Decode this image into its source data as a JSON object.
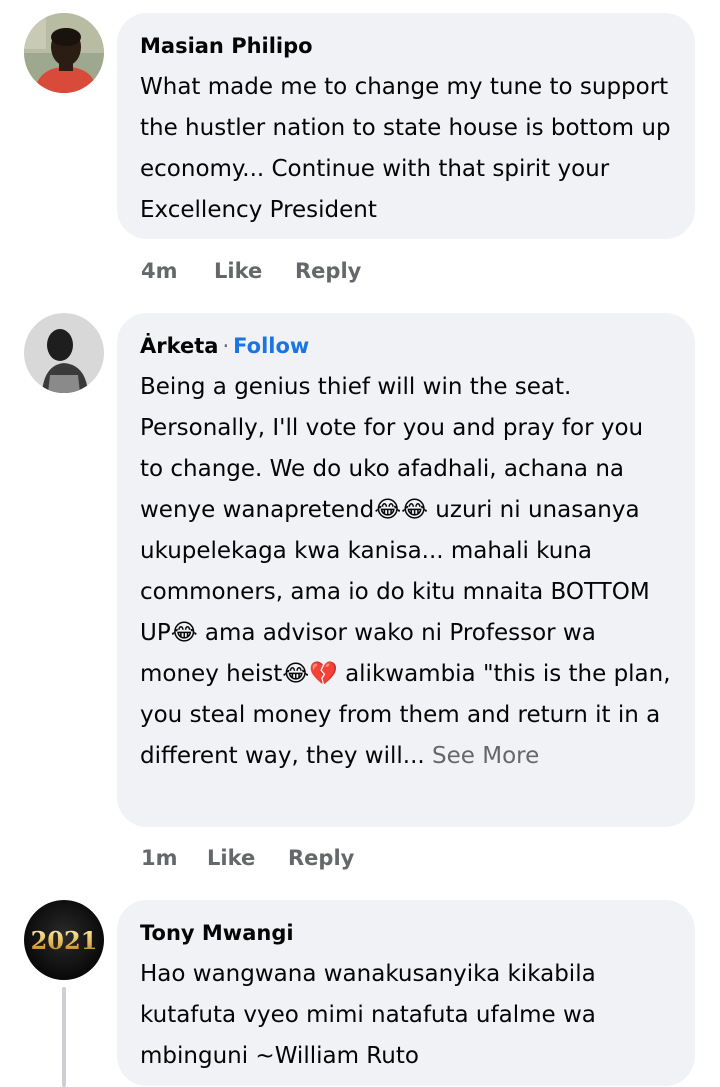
{
  "comments": [
    {
      "author": "Masian Philipo",
      "text": "What made me to change my tune to support the hustler nation to state house is bottom up economy... Continue with that spirit your Excellency President",
      "time": "4m",
      "like_label": "Like",
      "reply_label": "Reply"
    },
    {
      "author": "Ȧrketa",
      "separator": "·",
      "follow_label": "Follow",
      "text": "Being a genius thief will win the seat. Personally, I'll vote for you and pray for you to change. We do uko afadhali, achana na wenye wanapretend😂😂 uzuri ni unasanya ukupelekaga kwa kanisa... mahali kuna commoners, ama io do kitu mnaita BOTTOM UP😂 ama advisor wako ni Professor wa money heist😂💔 alikwambia \"this is the plan, you steal money from them and return it in a different way, they will...",
      "see_more_label": "See More",
      "time": "1m",
      "like_label": "Like",
      "reply_label": "Reply"
    },
    {
      "author": "Tony Mwangi",
      "avatar_text": "2021",
      "text": "Hao wangwana wanakusanyika kikabila kutafuta vyeo mimi natafuta ufalme wa mbinguni ~William Ruto"
    }
  ],
  "colors": {
    "bubble": "#f0f2f5",
    "text": "#050505",
    "muted": "#65676b",
    "link": "#1b74e4"
  }
}
